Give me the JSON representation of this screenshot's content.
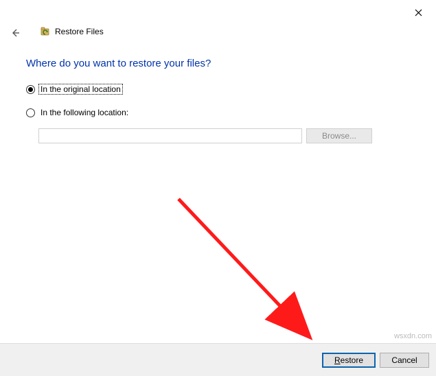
{
  "window": {
    "title": "Restore Files"
  },
  "heading": "Where do you want to restore your files?",
  "options": {
    "original": "In the original location",
    "following": "In the following location:"
  },
  "path_value": "",
  "browse_label": "Browse...",
  "footer": {
    "restore_label_underline": "R",
    "restore_label_rest": "estore",
    "cancel_label": "Cancel"
  },
  "watermark": "wsxdn.com"
}
